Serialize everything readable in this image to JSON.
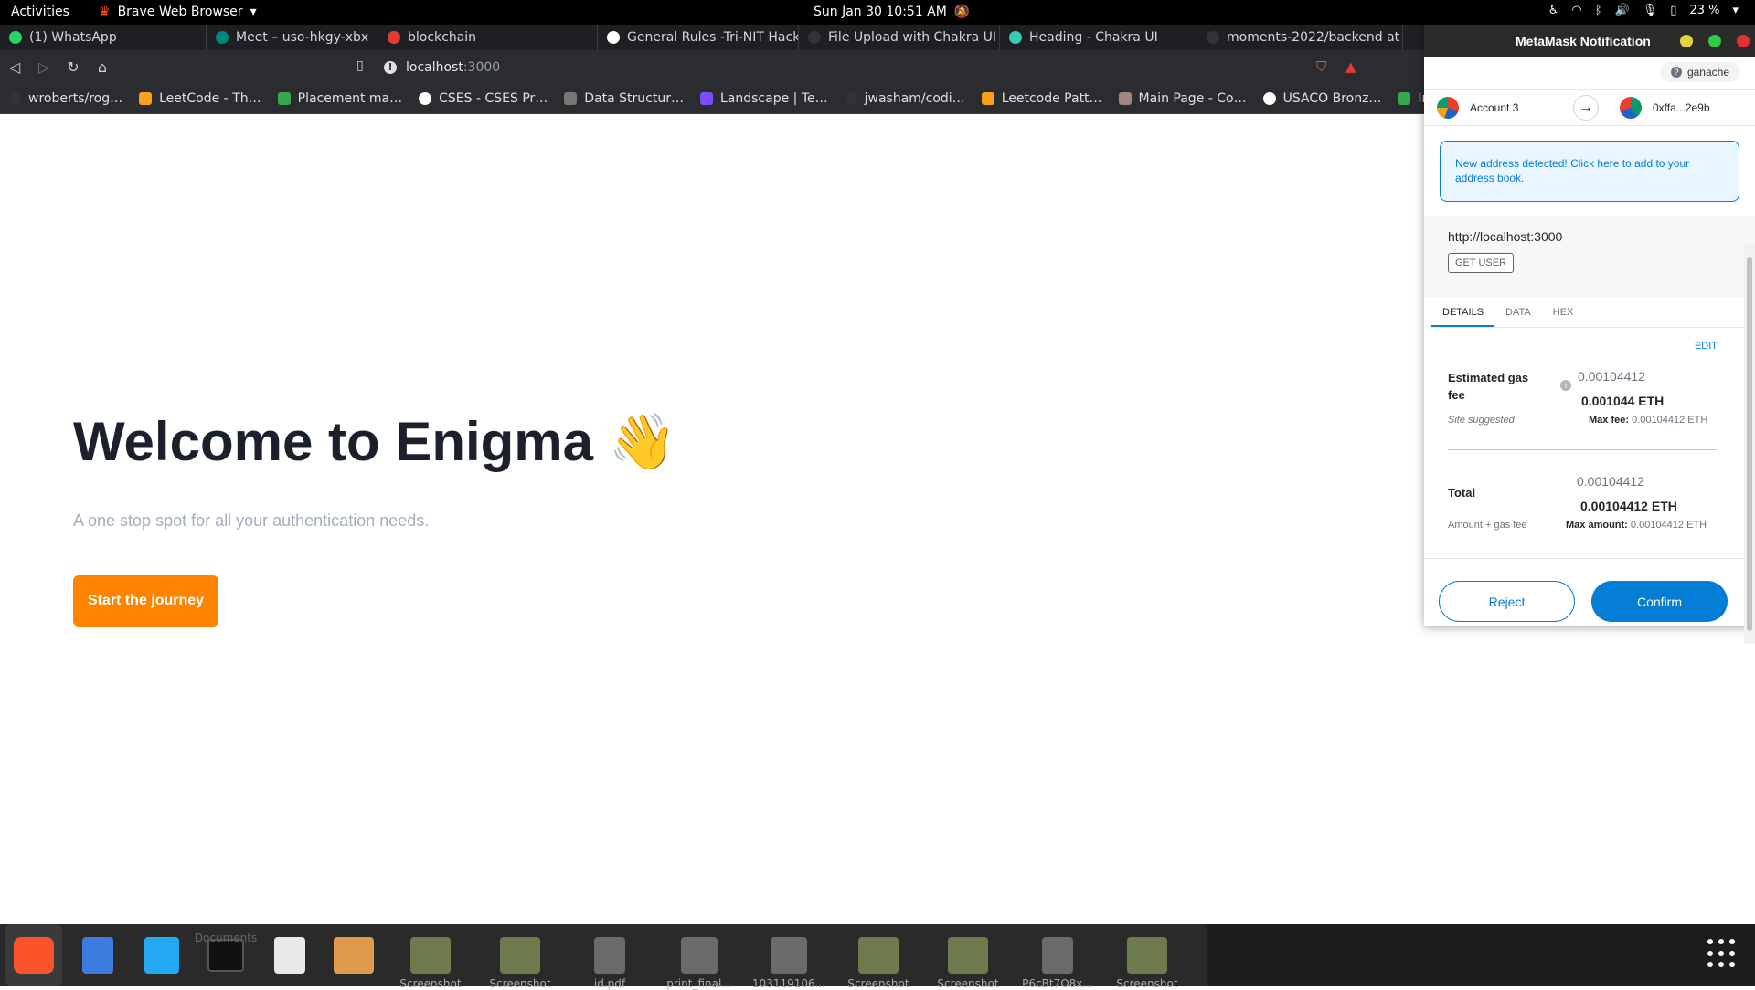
{
  "topbar": {
    "activities": "Activities",
    "app_name": "Brave Web Browser",
    "clock": "Sun Jan 30  10:51 AM",
    "battery": "23 %"
  },
  "tabs": [
    {
      "label": "(1) WhatsApp",
      "color": "#25d366"
    },
    {
      "label": "Meet – uso-hkgy-xbx",
      "color": "#00897b"
    },
    {
      "label": "blockchain",
      "color": "#e53935"
    },
    {
      "label": "General Rules -Tri-NIT Hack",
      "color": "#ffffff"
    },
    {
      "label": "File Upload with Chakra UI",
      "color": "#333333"
    },
    {
      "label": "Heading - Chakra UI",
      "color": "#3dc9b0"
    },
    {
      "label": "moments-2022/backend at",
      "color": "#333333"
    }
  ],
  "address": {
    "host": "localhost",
    "port": ":3000"
  },
  "bookmarks": [
    {
      "label": "wroberts/rog…",
      "color": "#333333"
    },
    {
      "label": "LeetCode - Th…",
      "color": "#f89f1b"
    },
    {
      "label": "Placement ma…",
      "color": "#34a853"
    },
    {
      "label": "CSES - CSES Pr…",
      "color": "#ffffff"
    },
    {
      "label": "Data Structur…",
      "color": "#777777"
    },
    {
      "label": "Landscape | Te…",
      "color": "#7c4dff"
    },
    {
      "label": "jwasham/codi…",
      "color": "#333333"
    },
    {
      "label": "Leetcode Patt…",
      "color": "#f89f1b"
    },
    {
      "label": "Main Page - Co…",
      "color": "#a1887f"
    },
    {
      "label": "USACO Bronz…",
      "color": "#ffffff"
    },
    {
      "label": "Int",
      "color": "#34a853"
    }
  ],
  "page": {
    "title": "Welcome to Enigma 👋",
    "subtitle": "A one stop spot for all your authentication needs.",
    "cta": "Start the journey"
  },
  "metamask": {
    "window_title": "MetaMask Notification",
    "network": "ganache",
    "from_account": "Account 3",
    "to_account": "0xffa...2e9b",
    "banner": "New address detected! Click here to add to your address book.",
    "origin": "http://localhost:3000",
    "method": "GET USER",
    "tabs": [
      "DETAILS",
      "DATA",
      "HEX"
    ],
    "edit": "EDIT",
    "gas_label": "Estimated gas fee",
    "gas_sub": "Site suggested",
    "gas_value": "0.00104412",
    "gas_eth": "0.001044 ETH",
    "max_fee_label": "Max fee:",
    "max_fee_value": "0.00104412 ETH",
    "total_label": "Total",
    "total_sub": "Amount + gas fee",
    "total_value": "0.00104412",
    "total_eth": "0.00104412 ETH",
    "max_amount_label": "Max amount:",
    "max_amount_value": "0.00104412 ETH",
    "reject": "Reject",
    "confirm": "Confirm"
  },
  "dock": [
    {
      "label": "",
      "color": "#fb542b"
    },
    {
      "label": "",
      "color": "#3d7be0"
    },
    {
      "label": "",
      "color": "#23a9f2"
    },
    {
      "label": "Documents",
      "color": "#333333"
    },
    {
      "label": "",
      "color": "#e8e8e8"
    },
    {
      "label": "",
      "color": "#e09a4b"
    },
    {
      "label": "Screenshot",
      "color": "#6d7b4d"
    },
    {
      "label": "Screenshot",
      "color": "#6d7b4d"
    },
    {
      "label": "id.pdf",
      "color": "#6b6b6b"
    },
    {
      "label": "print_final...",
      "color": "#6b6b6b"
    },
    {
      "label": "103119106...",
      "color": "#6b6b6b"
    },
    {
      "label": "Screenshot",
      "color": "#6d7b4d"
    },
    {
      "label": "Screenshot",
      "color": "#6d7b4d"
    },
    {
      "label": "P6cBt7O8x...",
      "color": "#6b6b6b"
    },
    {
      "label": "Screenshot",
      "color": "#6d7b4d"
    }
  ]
}
